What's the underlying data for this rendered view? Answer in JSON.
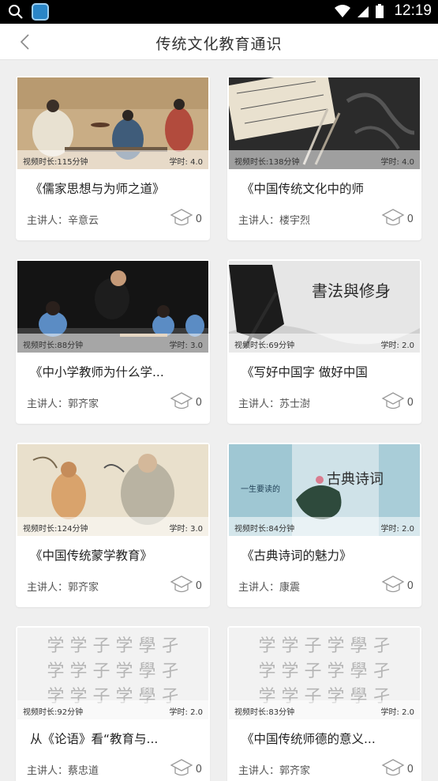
{
  "status_bar": {
    "time": "12:19"
  },
  "header": {
    "title": "传统文化教育通识"
  },
  "courses": [
    {
      "title": "《儒家思想与为师之道》",
      "duration": "视频时长:115分钟",
      "hours": "学时: 4.0",
      "speaker": "主讲人：辛意云",
      "count": "0"
    },
    {
      "title": "《中国传统文化中的师",
      "duration": "视频时长:138分钟",
      "hours": "学时: 4.0",
      "speaker": "主讲人：楼宇烈",
      "count": "0"
    },
    {
      "title": "《中小学教师为什么学...",
      "duration": "视频时长:88分钟",
      "hours": "学时: 3.0",
      "speaker": "主讲人：郭齐家",
      "count": "0"
    },
    {
      "title": "《写好中国字 做好中国",
      "duration": "视频时长:69分钟",
      "hours": "学时: 2.0",
      "speaker": "主讲人：苏士澍",
      "count": "0",
      "thumb_text": "書法與修身"
    },
    {
      "title": "《中国传统蒙学教育》",
      "duration": "视频时长:124分钟",
      "hours": "学时: 3.0",
      "speaker": "主讲人：郭齐家",
      "count": "0"
    },
    {
      "title": "《古典诗词的魅力》",
      "duration": "视频时长:84分钟",
      "hours": "学时: 2.0",
      "speaker": "主讲人：康震",
      "count": "0",
      "thumb_text_big": "古典诗词",
      "thumb_text_small": "一生要读的"
    },
    {
      "title": "从《论语》看“教育与...",
      "duration": "视频时长:92分钟",
      "hours": "学时: 2.0",
      "speaker": "主讲人：蔡忠道",
      "count": "0",
      "thumb_chars": "学 学 子 学 學 孑"
    },
    {
      "title": "《中国传统师德的意义...",
      "duration": "视频时长:83分钟",
      "hours": "学时: 2.0",
      "speaker": "主讲人：郭齐家",
      "count": "0",
      "thumb_chars": "学 学 子 学 學 孑"
    }
  ],
  "colors": {
    "accent": "#2a86c7",
    "card_bg": "#ffffff",
    "page_bg": "#efefef"
  }
}
